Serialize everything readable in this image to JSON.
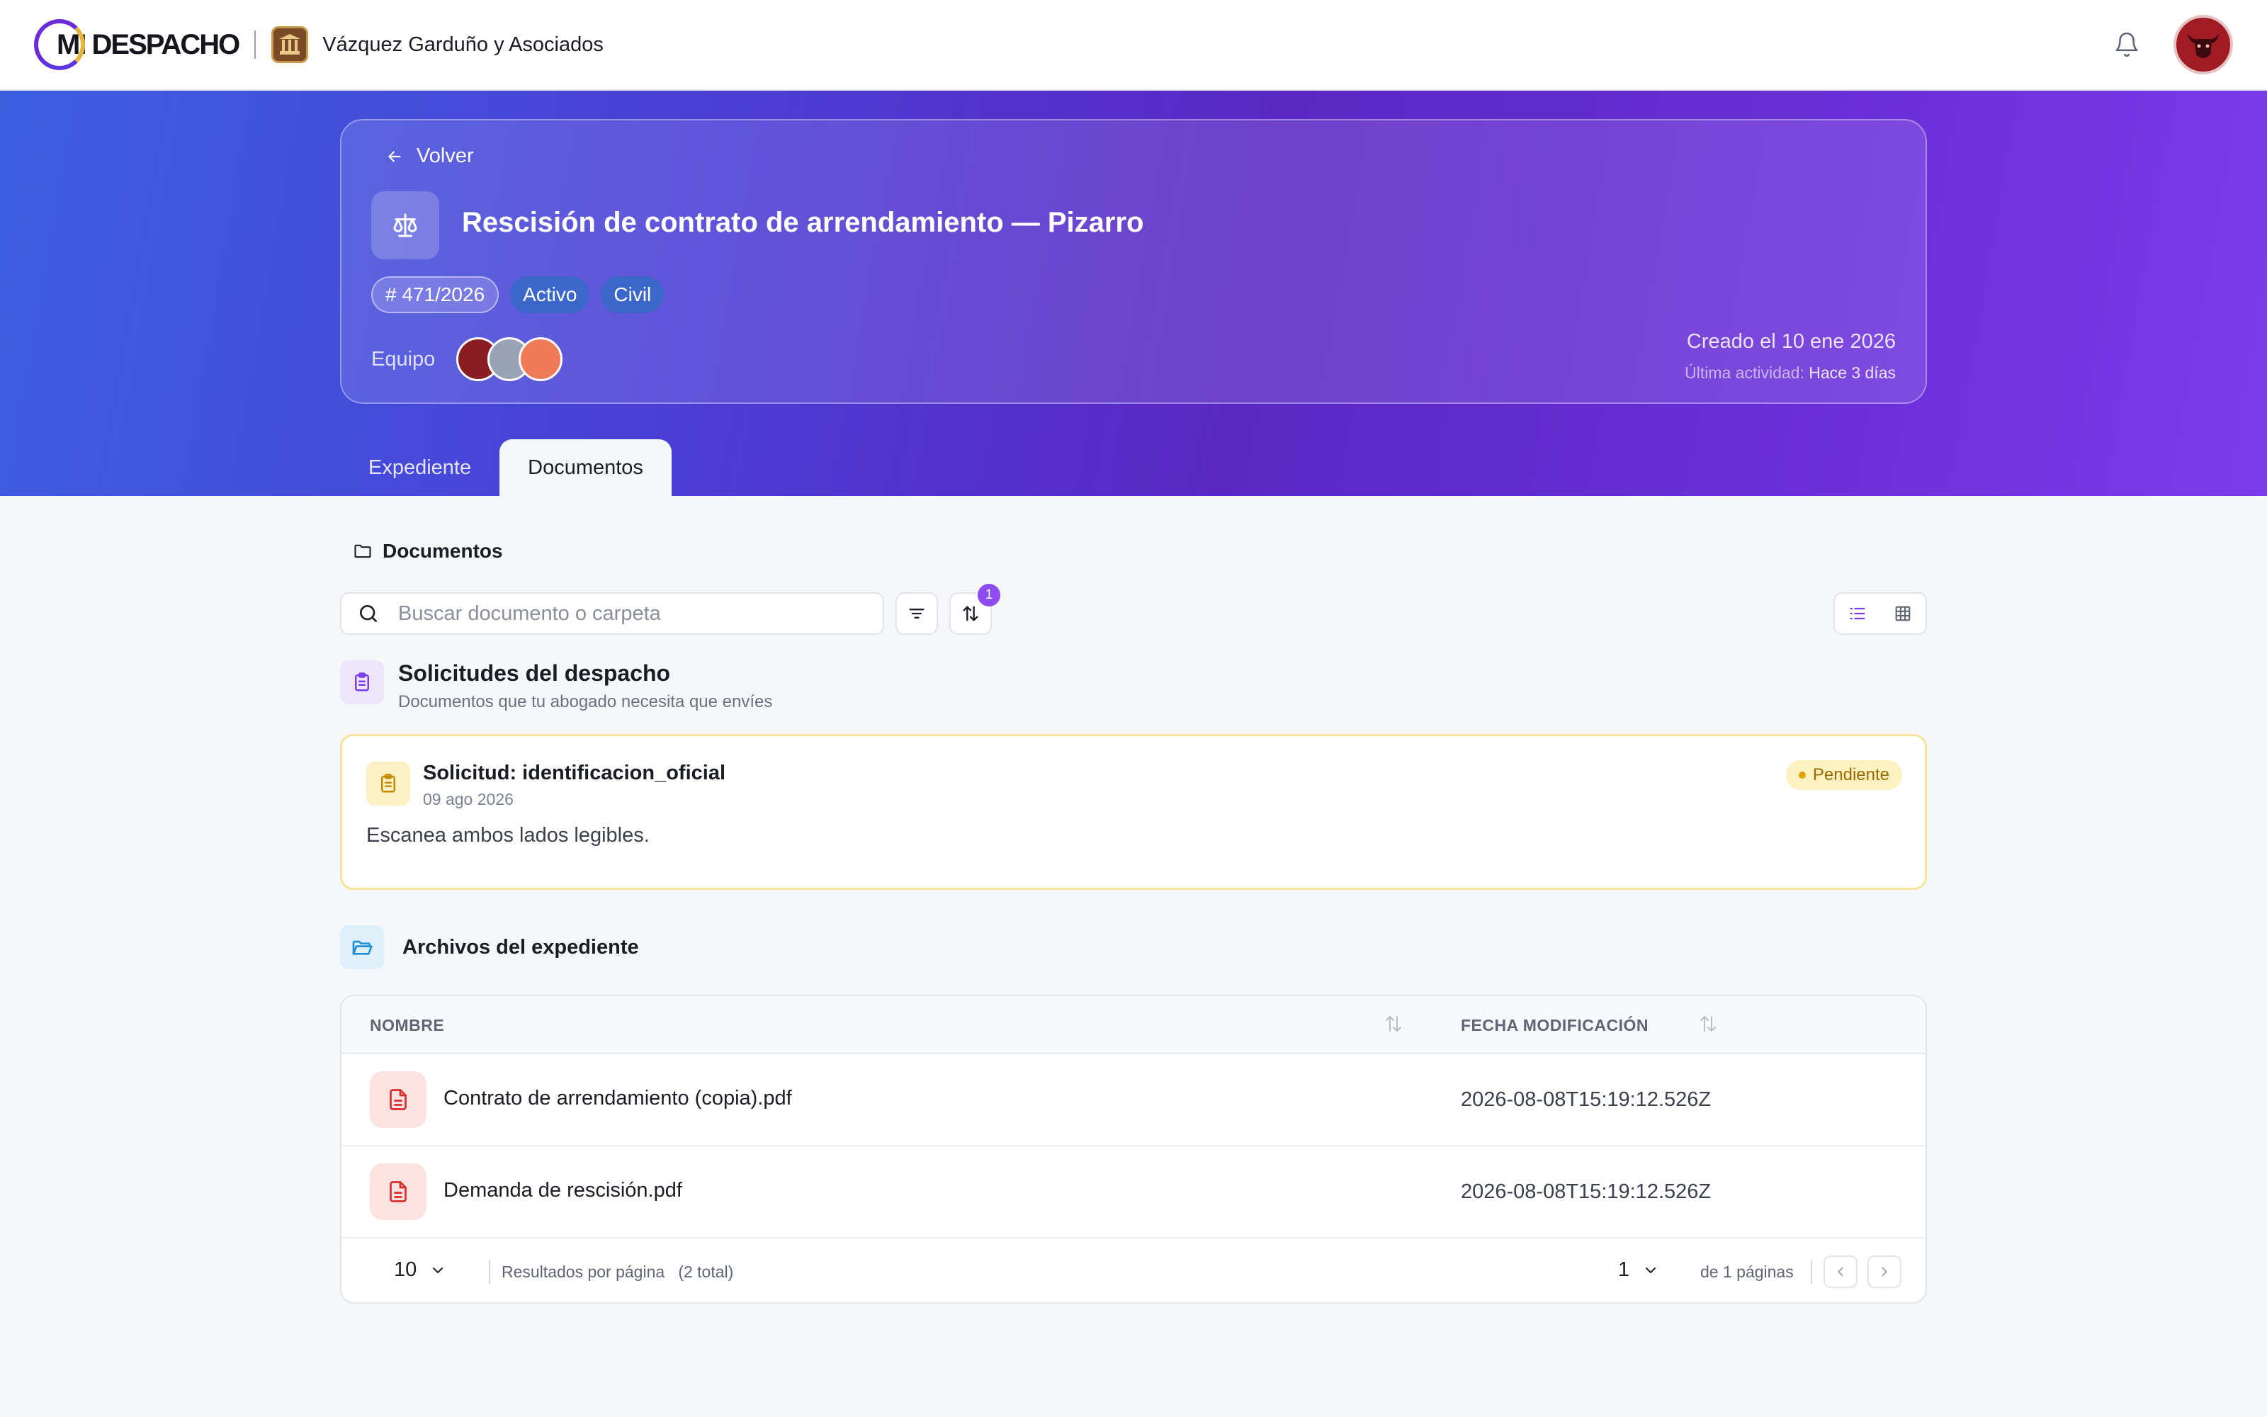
{
  "app": {
    "logo_text": "MI DESPACHO",
    "firm_name": "Vázquez Garduño y Asociados"
  },
  "case": {
    "back_label": "Volver",
    "title": "Rescisión de contrato de arrendamiento — Pizarro",
    "number": "# 471/2026",
    "status": "Activo",
    "area": "Civil",
    "team_label": "Equipo",
    "created": "Creado el 10 ene 2026",
    "last_activity_label": "Última actividad:",
    "last_activity_value": "Hace 3 días"
  },
  "tabs": [
    {
      "label": "Expediente",
      "active": false
    },
    {
      "label": "Documentos",
      "active": true
    }
  ],
  "documents": {
    "section_label": "Documentos",
    "search_placeholder": "Buscar documento o carpeta",
    "sort_badge": "1"
  },
  "requests": {
    "title": "Solicitudes del despacho",
    "subtitle": "Documentos que tu abogado necesita que envíes",
    "items": [
      {
        "title": "Solicitud: identificacion_oficial",
        "date": "09 ago 2026",
        "description": "Escanea ambos lados legibles.",
        "status": "Pendiente"
      }
    ]
  },
  "files": {
    "title": "Archivos del expediente",
    "columns": [
      "NOMBRE",
      "FECHA MODIFICACIÓN"
    ],
    "rows": [
      {
        "name": "Contrato de arrendamiento (copia).pdf",
        "modified": "2026-08-08T15:19:12.526Z"
      },
      {
        "name": "Demanda de rescisión.pdf",
        "modified": "2026-08-08T15:19:12.526Z"
      }
    ],
    "per_page": "10",
    "per_page_label": "Resultados por página   (2 total)",
    "page": "1",
    "of_pages": "de 1 páginas"
  },
  "colors": {
    "accent": "#7b3cea",
    "pending": "#9a6a00",
    "pdf": "#d92d2d"
  }
}
